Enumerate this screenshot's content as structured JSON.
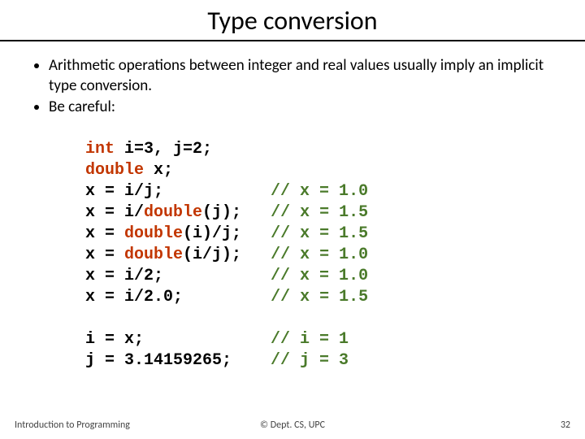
{
  "title": "Type conversion",
  "bullets": [
    "Arithmetic operations between integer and real values usually imply an implicit type conversion.",
    "Be careful:"
  ],
  "code": {
    "l1a": "int",
    "l1b": " i=3, j=2;",
    "l2a": "double",
    "l2b": " x;",
    "l3a": "x = i/j;",
    "l3c": "// x = 1.0",
    "l4a": "x = i/",
    "l4b": "double",
    "l4c": "(j);",
    "l4d": "// x = 1.5",
    "l5a": "x = ",
    "l5b": "double",
    "l5c": "(i)/j;",
    "l5d": "// x = 1.5",
    "l6a": "x = ",
    "l6b": "double",
    "l6c": "(i/j);",
    "l6d": "// x = 1.0",
    "l7a": "x = i/2;",
    "l7c": "// x = 1.0",
    "l8a": "x = i/2.0;",
    "l8c": "// x = 1.5",
    "l9a": "i = x;",
    "l9c": "// i = 1",
    "l10a": "j = 3.14159265;",
    "l10c": "// j = 3"
  },
  "footer": {
    "left": "Introduction to Programming",
    "center": "© Dept. CS, UPC",
    "right": "32"
  }
}
